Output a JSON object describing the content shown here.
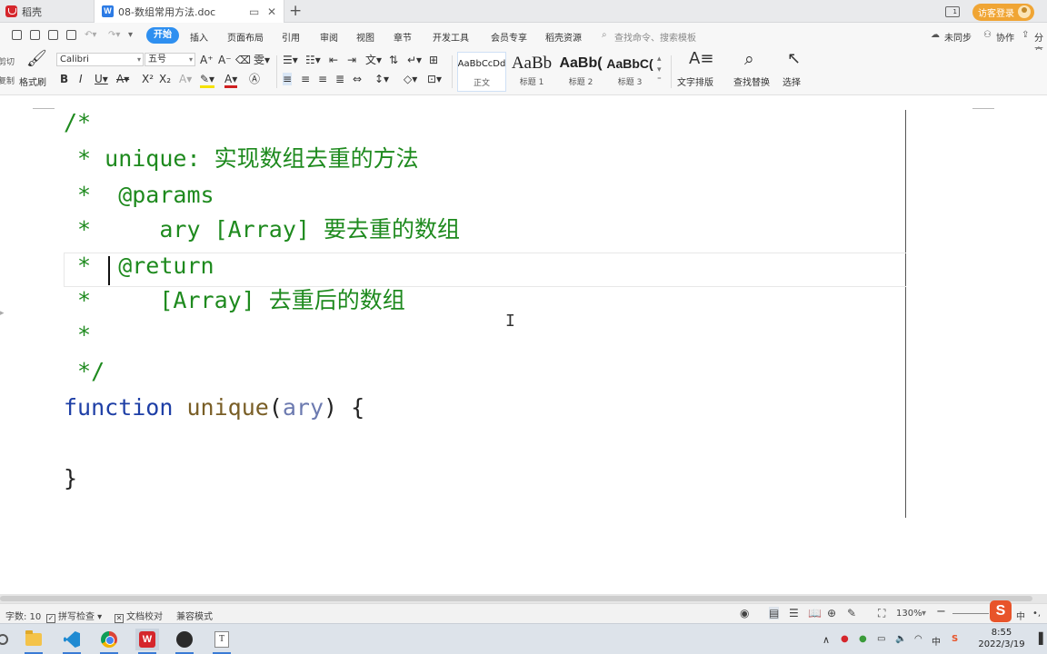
{
  "tabs": {
    "home_label": "稻壳",
    "doc_label": "08-数组常用方法.doc",
    "close_glyph": "✕",
    "pin_glyph": "▭",
    "new_tab_glyph": "+"
  },
  "account": {
    "window_badge": "1",
    "login_label": "访客登录"
  },
  "menu": {
    "items": [
      "开始",
      "插入",
      "页面布局",
      "引用",
      "审阅",
      "视图",
      "章节",
      "开发工具",
      "会员专享",
      "稻壳资源"
    ],
    "search_placeholder": "查找命令、搜索模板",
    "sync_label": "未同步",
    "collab_label": "协作",
    "share_label": "分享"
  },
  "ribbon": {
    "cut_label": "剪切",
    "copy_label": "复制",
    "format_painter_label": "格式刷",
    "font_name": "Calibri",
    "font_size": "五号",
    "styles": [
      {
        "sample": "AaBbCcDd",
        "name": "正文"
      },
      {
        "sample": "AaBb",
        "name": "标题 1"
      },
      {
        "sample": "AaBb(",
        "name": "标题 2"
      },
      {
        "sample": "AaBbC(",
        "name": "标题 3"
      }
    ],
    "text_layout_label": "文字排版",
    "find_replace_label": "查找替换",
    "select_label": "选择"
  },
  "document": {
    "lines": [
      {
        "parts": [
          {
            "t": "/*",
            "c": "cm"
          }
        ]
      },
      {
        "parts": [
          {
            "t": " * unique: 实现数组去重的方法",
            "c": "cm"
          }
        ]
      },
      {
        "parts": [
          {
            "t": " *  @params",
            "c": "cm"
          }
        ]
      },
      {
        "parts": [
          {
            "t": " *     ary [Array] 要去重的数组",
            "c": "cm"
          }
        ]
      },
      {
        "parts": [
          {
            "t": " *  @return",
            "c": "cm"
          }
        ]
      },
      {
        "parts": [
          {
            "t": " *     [Array] 去重后的数组",
            "c": "cm"
          }
        ]
      },
      {
        "parts": [
          {
            "t": " *",
            "c": "cm"
          }
        ]
      },
      {
        "parts": [
          {
            "t": " */",
            "c": "cm"
          }
        ]
      },
      {
        "parts": [
          {
            "t": "function",
            "c": "kw"
          },
          {
            "t": " ",
            "c": "pn"
          },
          {
            "t": "unique",
            "c": "fn"
          },
          {
            "t": "(",
            "c": "pn"
          },
          {
            "t": "ary",
            "c": "pm"
          },
          {
            "t": ") {",
            "c": "pn"
          }
        ]
      },
      {
        "parts": [
          {
            "t": "",
            "c": "pn"
          }
        ]
      },
      {
        "parts": [
          {
            "t": "}",
            "c": "pn"
          }
        ]
      }
    ]
  },
  "status": {
    "word_count": "字数: 10",
    "spellcheck": "拼写检查",
    "doc_proof": "文档校对",
    "compat_mode": "兼容模式",
    "zoom": "130%"
  },
  "taskbar": {
    "ime_cn": "中",
    "time": "8:55",
    "date": "2022/3/19"
  },
  "colors": {
    "accent": "#2e8ff0",
    "comment": "#1e8a1e",
    "keyword": "#1e3fa6",
    "function_name": "#795e26",
    "param": "#6c7ab0"
  }
}
